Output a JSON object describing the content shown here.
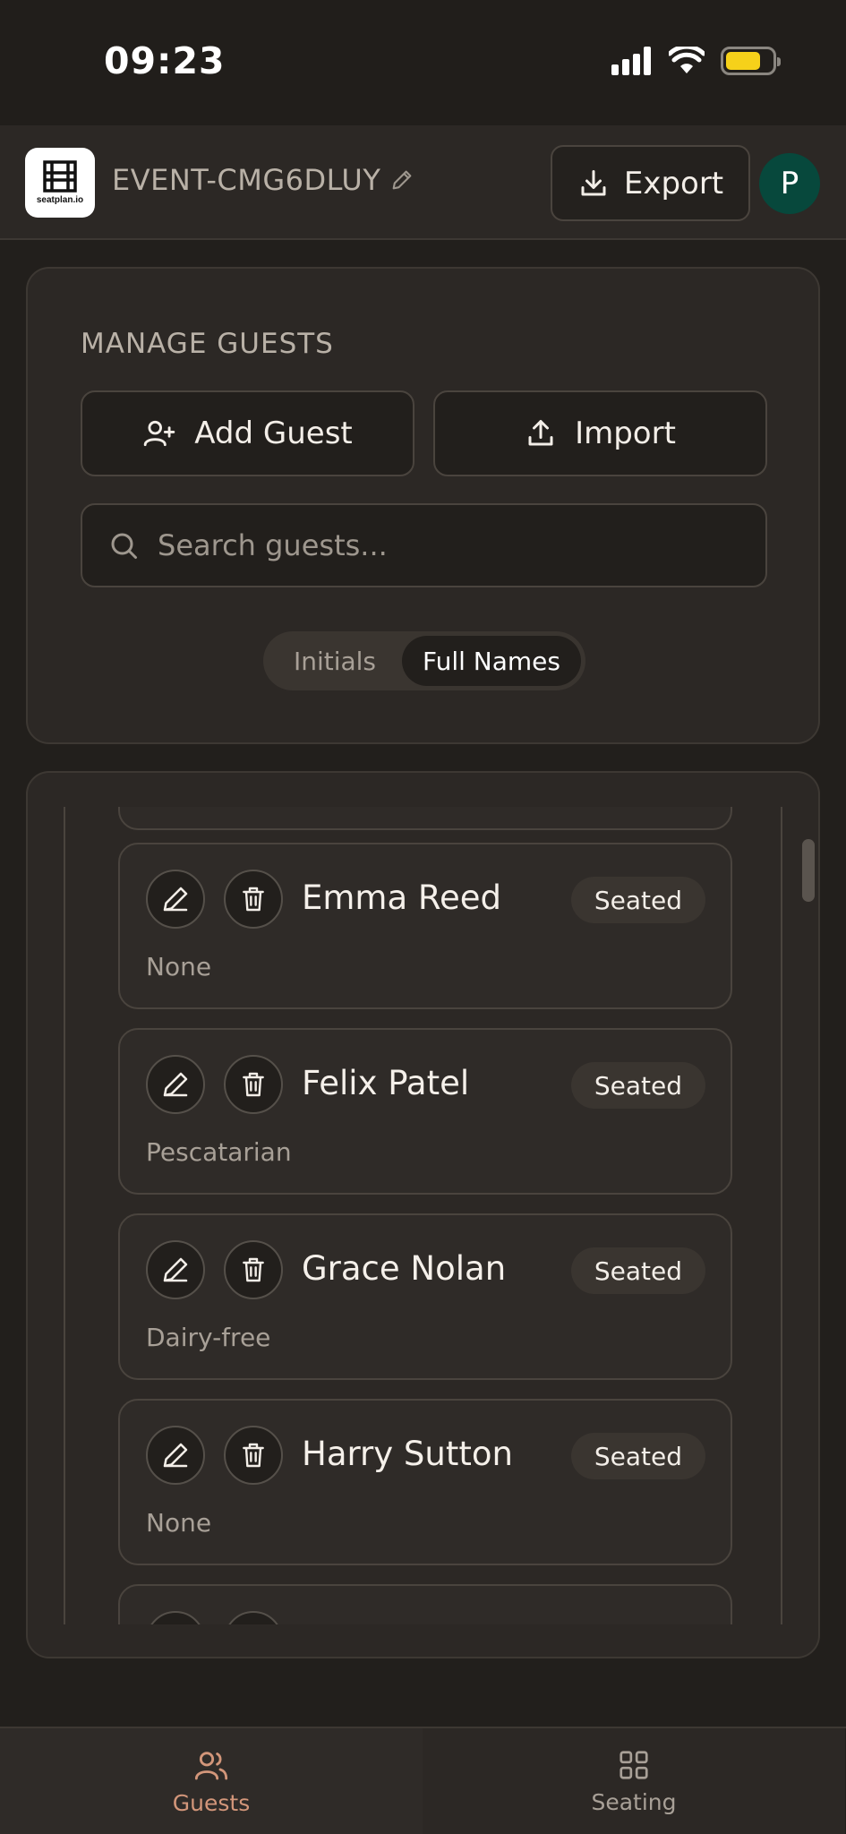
{
  "status_bar": {
    "time": "09:23"
  },
  "header": {
    "logo_text": "seatplan.io",
    "event_name": "EVENT-CMG6DLUY",
    "export_label": "Export",
    "avatar_initial": "P"
  },
  "manage": {
    "title": "MANAGE GUESTS",
    "add_guest_label": "Add Guest",
    "import_label": "Import",
    "search_placeholder": "Search guests...",
    "toggle": {
      "initials": "Initials",
      "full_names": "Full Names",
      "selected": "Full Names"
    }
  },
  "guests": [
    {
      "name": "Emma Reed",
      "status": "Seated",
      "dietary": "None"
    },
    {
      "name": "Felix Patel",
      "status": "Seated",
      "dietary": "Pescatarian"
    },
    {
      "name": "Grace Nolan",
      "status": "Seated",
      "dietary": "Dairy-free"
    },
    {
      "name": "Harry Sutton",
      "status": "Seated",
      "dietary": "None"
    }
  ],
  "bottom_nav": {
    "guests_label": "Guests",
    "seating_label": "Seating",
    "active": "Guests"
  },
  "colors": {
    "background": "#221f1c",
    "card": "#2c2825",
    "accent": "#d3967a",
    "avatar": "#07483c",
    "battery": "#f6d11a"
  }
}
